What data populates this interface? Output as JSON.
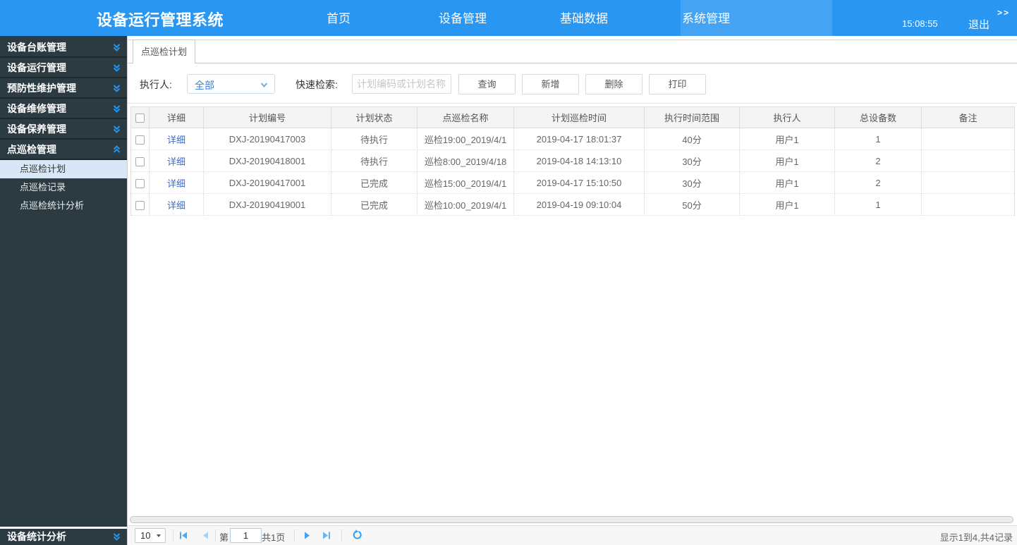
{
  "header": {
    "title": "设备运行管理系统",
    "nav": [
      {
        "label": "首页"
      },
      {
        "label": "设备管理"
      },
      {
        "label": "基础数据"
      },
      {
        "label": "系统管理"
      }
    ],
    "time": "15:08:55",
    "logout_label": "退出",
    "expand_label": ">>"
  },
  "sidebar": {
    "items": [
      {
        "label": "设备台账管理"
      },
      {
        "label": "设备运行管理"
      },
      {
        "label": "预防性维护管理"
      },
      {
        "label": "设备维修管理"
      },
      {
        "label": "设备保养管理"
      },
      {
        "label": "点巡检管理"
      },
      {
        "label": "设备统计分析"
      }
    ],
    "submenu": [
      {
        "label": "点巡检计划",
        "selected": true
      },
      {
        "label": "点巡检记录",
        "selected": false
      },
      {
        "label": "点巡检统计分析",
        "selected": false
      }
    ]
  },
  "tab": {
    "label": "点巡检计划"
  },
  "filters": {
    "executor_label": "执行人:",
    "executor_value": "全部",
    "search_label": "快速检索:",
    "search_placeholder": "计划编码或计划名称",
    "buttons": [
      {
        "label": "查询"
      },
      {
        "label": "新增"
      },
      {
        "label": "删除"
      },
      {
        "label": "打印"
      }
    ]
  },
  "table": {
    "columns": [
      "详细",
      "计划编号",
      "计划状态",
      "点巡检名称",
      "计划巡检时间",
      "执行时间范围",
      "执行人",
      "总设备数",
      "备注"
    ],
    "rows": [
      {
        "detail": "详细",
        "code": "DXJ-20190417003",
        "status": "待执行",
        "name": "巡检19:00_2019/4/1",
        "time": "2019-04-17 18:01:37",
        "range": "40分",
        "executor": "用户1",
        "devices": "1",
        "remark": ""
      },
      {
        "detail": "详细",
        "code": "DXJ-20190418001",
        "status": "待执行",
        "name": "巡检8:00_2019/4/18",
        "time": "2019-04-18 14:13:10",
        "range": "30分",
        "executor": "用户1",
        "devices": "2",
        "remark": ""
      },
      {
        "detail": "详细",
        "code": "DXJ-20190417001",
        "status": "已完成",
        "name": "巡检15:00_2019/4/1",
        "time": "2019-04-17 15:10:50",
        "range": "30分",
        "executor": "用户1",
        "devices": "2",
        "remark": ""
      },
      {
        "detail": "详细",
        "code": "DXJ-20190419001",
        "status": "已完成",
        "name": "巡检10:00_2019/4/1",
        "time": "2019-04-19 09:10:04",
        "range": "50分",
        "executor": "用户1",
        "devices": "1",
        "remark": ""
      }
    ]
  },
  "pager": {
    "page_size": "10",
    "page_prefix": "第",
    "current_page": "1",
    "page_suffix": "共1页",
    "status": "显示1到4,共4记录"
  },
  "colors": {
    "header_blue": "#2996f2",
    "sidebar_dark": "#2c3b41",
    "selected_light": "#d7e7f7",
    "accent_blue": "#2196f3",
    "link_blue": "#3d6dcc"
  }
}
